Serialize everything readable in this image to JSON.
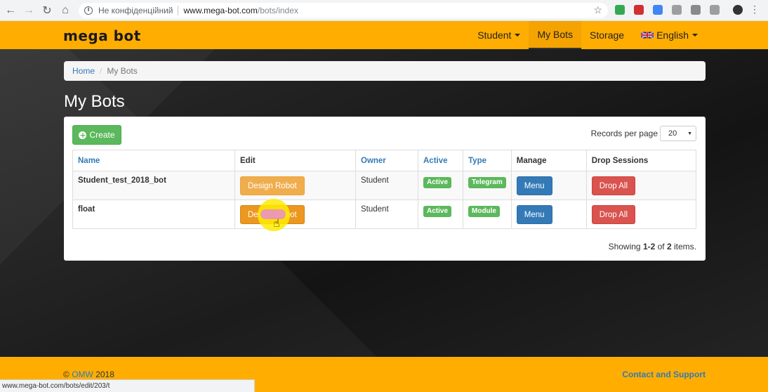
{
  "browser": {
    "secure_label": "Не конфіденційний",
    "url_host": "www.mega-bot.com",
    "url_path": "/bots/index",
    "status_url": "www.mega-bot.com/bots/edit/203/t",
    "extension_colors": [
      "#34a853",
      "#d32f2f",
      "#4285f4",
      "#9e9e9e",
      "#8a8a8a",
      "#9e9e9e"
    ]
  },
  "navbar": {
    "brand": "mega bot",
    "links": [
      {
        "label": "Student"
      },
      {
        "label": "My Bots"
      },
      {
        "label": "Storage"
      },
      {
        "label": "English"
      }
    ]
  },
  "breadcrumb": {
    "home": "Home",
    "separator": "/",
    "current": "My Bots"
  },
  "page": {
    "title": "My Bots",
    "create_label": "Create",
    "records_label": "Records per page",
    "records_value": "20"
  },
  "table": {
    "headers": [
      "Name",
      "Edit",
      "Owner",
      "Active",
      "Type",
      "Manage",
      "Drop Sessions"
    ],
    "rows": [
      {
        "name": "Student_test_2018_bot",
        "edit": "Design Robot",
        "owner": "Student",
        "active": "Active",
        "type": "Telegram",
        "manage": "Menu",
        "drop": "Drop All"
      },
      {
        "name": "float",
        "edit": "Design Robot",
        "owner": "Student",
        "active": "Active",
        "type": "Module",
        "manage": "Menu",
        "drop": "Drop All"
      }
    ]
  },
  "summary": {
    "prefix": "Showing ",
    "range": "1-2",
    "middle": " of ",
    "total": "2",
    "suffix": " items."
  },
  "footer": {
    "copyright_symbol": "©",
    "company": "OMW",
    "year": "2018",
    "contact": "Contact and Support"
  }
}
